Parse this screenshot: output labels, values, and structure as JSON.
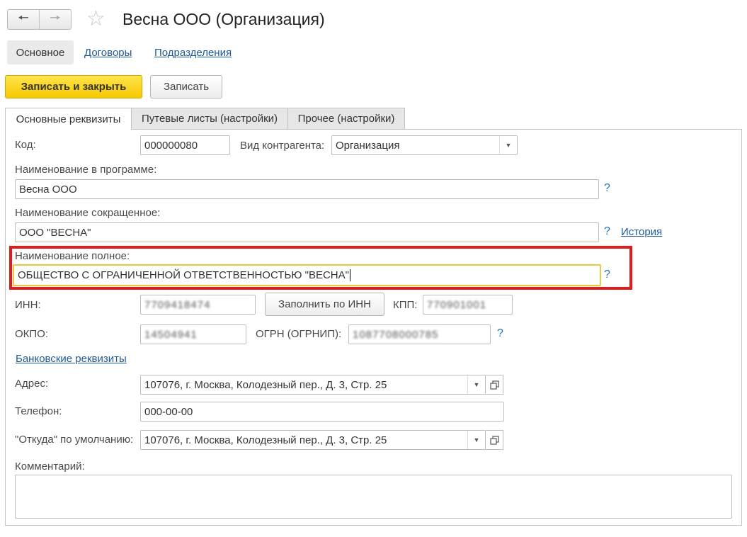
{
  "window": {
    "title": "Весна ООО (Организация)",
    "back_icon": "arrow-left-icon",
    "forward_icon": "arrow-right-icon",
    "favorite_icon": "star-icon"
  },
  "form_nav": {
    "main": "Основное",
    "contracts": "Договоры",
    "departments": "Подразделения"
  },
  "toolbar": {
    "save_close": "Записать и закрыть",
    "save": "Записать"
  },
  "tabs": [
    {
      "label": "Основные реквизиты",
      "active": true
    },
    {
      "label": "Путевые листы (настройки)",
      "active": false
    },
    {
      "label": "Прочее (настройки)",
      "active": false
    }
  ],
  "form": {
    "code_label": "Код:",
    "code_value": "000000080",
    "kind_label": "Вид контрагента:",
    "kind_value": "Организация",
    "name_prog_label": "Наименование в программе:",
    "name_prog_value": "Весна ООО",
    "name_short_label": "Наименование сокращенное:",
    "name_short_value": "ООО \"ВЕСНА\"",
    "history_link": "История",
    "name_full_label": "Наименование полное:",
    "name_full_value": "ОБЩЕСТВО С ОГРАНИЧЕННОЙ ОТВЕТСТВЕННОСТЬЮ \"ВЕСНА\"",
    "help": "?",
    "inn_label": "ИНН:",
    "inn_value": "7709418474",
    "fill_by_inn": "Заполнить по ИНН",
    "kpp_label": "КПП:",
    "kpp_value": "770901001",
    "okpo_label": "ОКПО:",
    "okpo_value": "14504941",
    "ogrn_label": "ОГРН (ОГРНИП):",
    "ogrn_value": "1087708000785",
    "bank_link": "Банковские реквизиты",
    "address_label": "Адрес:",
    "address_value": "107076, г. Москва, Колодезный пер., Д. 3, Стр. 25",
    "phone_label": "Телефон:",
    "phone_value": "000-00-00",
    "from_label": "\"Откуда\" по умолчанию:",
    "from_value": "107076, г. Москва, Колодезный пер., Д. 3, Стр. 25",
    "comment_label": "Комментарий:",
    "comment_value": ""
  },
  "colors": {
    "highlight_border": "#e01b1b",
    "primary_button": "#f5c800",
    "link": "#1e5a96"
  }
}
